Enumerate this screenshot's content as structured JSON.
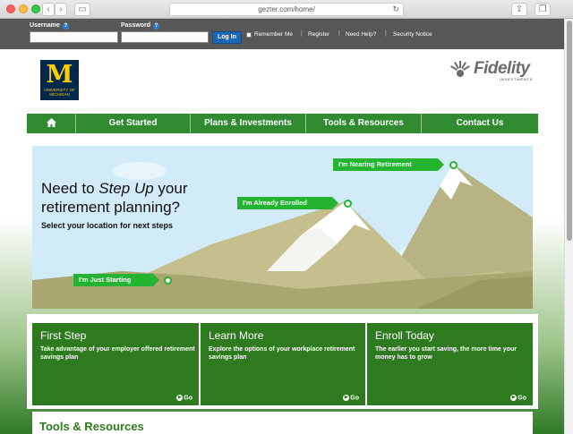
{
  "browser": {
    "url": "gezter.com/home/"
  },
  "login": {
    "username_label": "Username",
    "password_label": "Password",
    "help_mark": "?",
    "login_button": "Log In",
    "remember_label": "Remember Me",
    "links": [
      "Register",
      "Need Help?",
      "Security Notice"
    ]
  },
  "header": {
    "um_logo_letter": "M",
    "um_logo_text": "UNIVERSITY OF MICHIGAN",
    "fidelity_word": "Fidelity",
    "fidelity_sub": "INVESTMENTS"
  },
  "nav": {
    "items": [
      "Get Started",
      "Plans & Investments",
      "Tools & Resources",
      "Contact Us"
    ],
    "home_icon": "home-icon"
  },
  "hero": {
    "title_line1_a": "Need to ",
    "title_line1_em": "Step Up",
    "title_line1_b": " your",
    "title_line2": "retirement planning?",
    "subtitle": "Select your location for next steps",
    "flags": {
      "nearing": "I'm Nearing Retirement",
      "enrolled": "I'm Already Enrolled",
      "starting": "I'm Just Starting"
    },
    "colors": {
      "accent": "#25b432",
      "sky": "#cfe8f7",
      "mountain": "#c4bf8c"
    }
  },
  "panels": [
    {
      "title": "First Step",
      "desc": "Take advantage of your employer offered retirement savings plan",
      "go": "Go"
    },
    {
      "title": "Learn More",
      "desc": "Explore the options of your workplace retirement savings plan",
      "go": "Go"
    },
    {
      "title": "Enroll Today",
      "desc": "The earlier you start saving, the more time your money has to grow",
      "go": "Go"
    }
  ],
  "tools": {
    "title": "Tools & Resources"
  }
}
